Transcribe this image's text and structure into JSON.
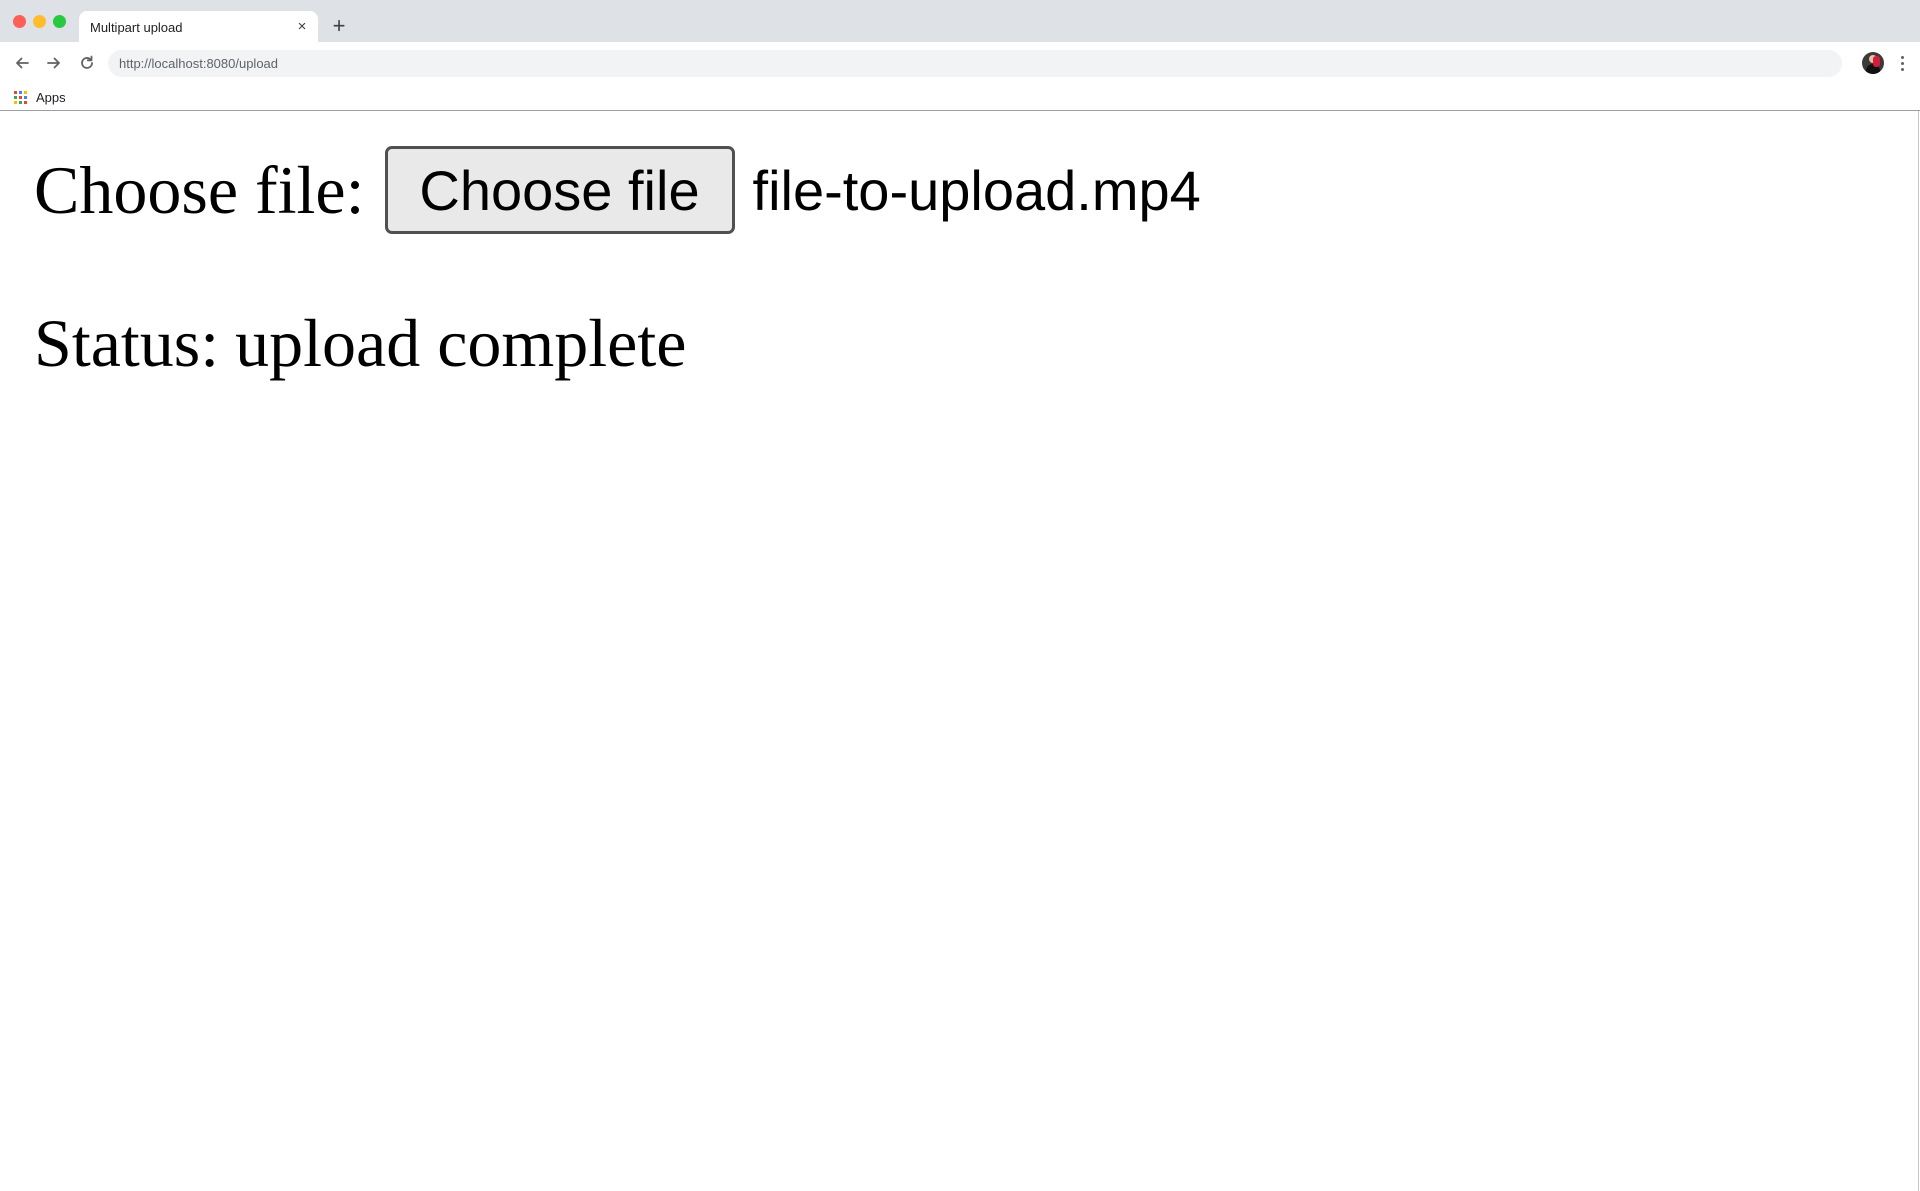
{
  "browser": {
    "tab": {
      "title": "Multipart upload",
      "close_glyph": "×"
    },
    "new_tab_glyph": "+",
    "address_bar": {
      "url": "http://localhost:8080/upload"
    },
    "bookmarks": [
      {
        "label": "Apps",
        "icon": "apps-grid-icon"
      }
    ],
    "icons": {
      "back": "arrow-left-icon",
      "forward": "arrow-right-icon",
      "reload": "reload-icon",
      "profile": "avatar",
      "menu": "kebab-menu-icon"
    }
  },
  "page": {
    "file_label": "Choose file:",
    "choose_button": "Choose file",
    "selected_file": "file-to-upload.mp4",
    "status_label": "Status:",
    "status_value": "upload complete"
  },
  "colors": {
    "tab_strip": "#dee1e6",
    "omnibox": "#f1f3f4",
    "traffic_close": "#fe5f57",
    "traffic_minimize": "#febc2e",
    "traffic_maximize": "#28c840",
    "button_face": "#e9e9e9",
    "button_border": "#505050"
  }
}
